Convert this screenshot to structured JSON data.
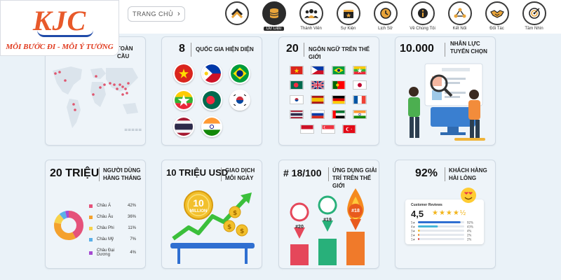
{
  "logo": {
    "brand": "KJC",
    "slogan": "MỖI BƯỚC ĐI - MỖI Ý TƯỞNG"
  },
  "breadcrumb": {
    "label": "TRANG CHỦ"
  },
  "nav": [
    {
      "label": "",
      "icon": "chevron-up-icon",
      "active": false
    },
    {
      "label": "Dữ Liệu",
      "icon": "database-icon",
      "active": true
    },
    {
      "label": "Thành Viên",
      "icon": "team-icon",
      "active": false
    },
    {
      "label": "Sự Kiện",
      "icon": "calendar-icon",
      "active": false
    },
    {
      "label": "Lịch Sử",
      "icon": "clock-icon",
      "active": false
    },
    {
      "label": "Về Chúng Tôi",
      "icon": "info-icon",
      "active": false
    },
    {
      "label": "Kết Nối",
      "icon": "network-icon",
      "active": false
    },
    {
      "label": "Đối Tác",
      "icon": "handshake-icon",
      "active": false
    },
    {
      "label": "Tầm Nhìn",
      "icon": "target-icon",
      "active": false
    }
  ],
  "cards": {
    "map": {
      "caption": "TOÀN CẦU"
    },
    "countries": {
      "stat": "8",
      "caption": "QUỐC GIA HIỆN DIỆN",
      "flags": [
        "Vietnam",
        "Philippines",
        "Brazil",
        "Myanmar",
        "Bangladesh",
        "South Korea",
        "Thailand",
        "India"
      ]
    },
    "languages": {
      "stat": "20",
      "caption": "NGÔN NGỮ TRÊN THẾ GIỚI",
      "flags": [
        "Vietnam",
        "Philippines",
        "Brazil",
        "Myanmar",
        "Bangladesh",
        "United Kingdom",
        "Portugal",
        "Japan",
        "South Korea",
        "Spain",
        "Germany",
        "France",
        "Thailand",
        "Russia",
        "UAE",
        "India",
        "Indonesia",
        "Singapore",
        "Turkey"
      ]
    },
    "staff": {
      "stat": "10.000",
      "caption_line1": "NHÂN LỰC",
      "caption_line2": "TUYỂN CHỌN"
    },
    "users": {
      "stat": "20 TRIỆU",
      "caption_line1": "NGƯỜI DÙNG",
      "caption_line2": "HÀNG THÁNG",
      "chart_data": {
        "type": "pie",
        "labels": [
          "Châu Á",
          "Châu Âu",
          "Châu Phi",
          "Châu Mỹ",
          "Châu Đại Dương"
        ],
        "values": [
          42,
          36,
          11,
          7,
          4
        ],
        "value_labels": [
          "42%",
          "36%",
          "11%",
          "7%",
          "4%"
        ],
        "colors": [
          "#e5527a",
          "#f4a12d",
          "#f7d24a",
          "#5ab0e8",
          "#a64bd1"
        ]
      }
    },
    "transactions": {
      "stat": "10 TRIỆU USD",
      "caption_line1": "GIAO DỊCH",
      "caption_line2": "MỖI NGÀY",
      "coin_top": "10",
      "coin_bottom": "MILLION"
    },
    "ranking": {
      "stat": "# 18/100",
      "caption_line1": "ỨNG DỤNG GIẢI",
      "caption_line2": "TRÍ TRÊN THẾ GIỚI",
      "pins": [
        "#20",
        "#19",
        "#18"
      ]
    },
    "satisfaction": {
      "stat": "92%",
      "caption_line1": "KHÁCH HÀNG",
      "caption_line2": "HÀI LÒNG",
      "review_title": "Customer Reviews",
      "rating": "4,5",
      "chart_data": {
        "type": "bar",
        "categories": [
          "5",
          "4",
          "3",
          "2",
          "1"
        ],
        "values": [
          92,
          43,
          4,
          2,
          2
        ],
        "value_labels": [
          "92%",
          "43%",
          "4%",
          "2%",
          "2%"
        ],
        "colors": [
          "#2f6fd1",
          "#45b6d9",
          "#f2c02c",
          "#f28f2c",
          "#e24a4a"
        ]
      }
    }
  }
}
